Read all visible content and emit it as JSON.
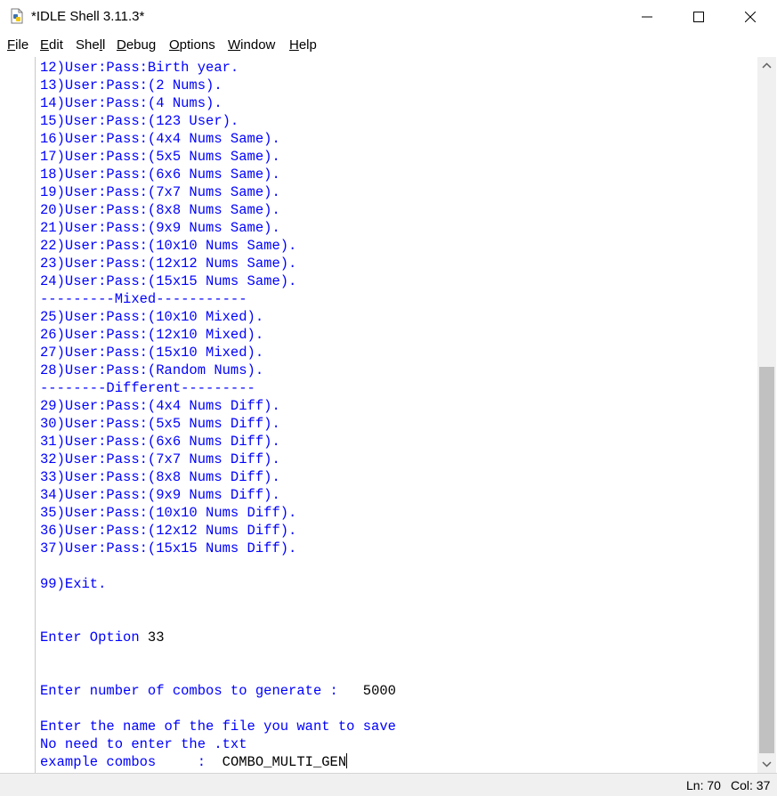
{
  "window": {
    "title": "*IDLE Shell 3.11.3*"
  },
  "menu": [
    "File",
    "Edit",
    "Shell",
    "Debug",
    "Options",
    "Window",
    "Help"
  ],
  "menu_mnemonics": [
    "F",
    "E",
    "l",
    "D",
    "O",
    "W",
    "H"
  ],
  "shell_lines": [
    {
      "text": "12)User:Pass:Birth year.",
      "kind": "output"
    },
    {
      "text": "13)User:Pass:(2 Nums).",
      "kind": "output"
    },
    {
      "text": "14)User:Pass:(4 Nums).",
      "kind": "output"
    },
    {
      "text": "15)User:Pass:(123 User).",
      "kind": "output"
    },
    {
      "text": "16)User:Pass:(4x4 Nums Same).",
      "kind": "output"
    },
    {
      "text": "17)User:Pass:(5x5 Nums Same).",
      "kind": "output"
    },
    {
      "text": "18)User:Pass:(6x6 Nums Same).",
      "kind": "output"
    },
    {
      "text": "19)User:Pass:(7x7 Nums Same).",
      "kind": "output"
    },
    {
      "text": "20)User:Pass:(8x8 Nums Same).",
      "kind": "output"
    },
    {
      "text": "21)User:Pass:(9x9 Nums Same).",
      "kind": "output"
    },
    {
      "text": "22)User:Pass:(10x10 Nums Same).",
      "kind": "output"
    },
    {
      "text": "23)User:Pass:(12x12 Nums Same).",
      "kind": "output"
    },
    {
      "text": "24)User:Pass:(15x15 Nums Same).",
      "kind": "output"
    },
    {
      "text": "---------Mixed-----------",
      "kind": "output"
    },
    {
      "text": "25)User:Pass:(10x10 Mixed).",
      "kind": "output"
    },
    {
      "text": "26)User:Pass:(12x10 Mixed).",
      "kind": "output"
    },
    {
      "text": "27)User:Pass:(15x10 Mixed).",
      "kind": "output"
    },
    {
      "text": "28)User:Pass:(Random Nums).",
      "kind": "output"
    },
    {
      "text": "--------Different---------",
      "kind": "output"
    },
    {
      "text": "29)User:Pass:(4x4 Nums Diff).",
      "kind": "output"
    },
    {
      "text": "30)User:Pass:(5x5 Nums Diff).",
      "kind": "output"
    },
    {
      "text": "31)User:Pass:(6x6 Nums Diff).",
      "kind": "output"
    },
    {
      "text": "32)User:Pass:(7x7 Nums Diff).",
      "kind": "output"
    },
    {
      "text": "33)User:Pass:(8x8 Nums Diff).",
      "kind": "output"
    },
    {
      "text": "34)User:Pass:(9x9 Nums Diff).",
      "kind": "output"
    },
    {
      "text": "35)User:Pass:(10x10 Nums Diff).",
      "kind": "output"
    },
    {
      "text": "36)User:Pass:(12x12 Nums Diff).",
      "kind": "output"
    },
    {
      "text": "37)User:Pass:(15x15 Nums Diff).",
      "kind": "output"
    },
    {
      "text": "",
      "kind": "output"
    },
    {
      "text": "99)Exit.",
      "kind": "output"
    },
    {
      "text": "",
      "kind": "output"
    },
    {
      "text": "",
      "kind": "output"
    },
    {
      "text": "Enter Option ",
      "kind": "output",
      "input": "33"
    },
    {
      "text": "",
      "kind": "output"
    },
    {
      "text": "",
      "kind": "output"
    },
    {
      "text": "Enter number of combos to generate :   ",
      "kind": "output",
      "input": "5000"
    },
    {
      "text": "",
      "kind": "output"
    },
    {
      "text": "Enter the name of the file you want to save",
      "kind": "output"
    },
    {
      "text": "No need to enter the .txt",
      "kind": "output"
    },
    {
      "text": "example combos     :  ",
      "kind": "output",
      "input": "COMBO_MULTI_GEN",
      "cursor": true
    }
  ],
  "status": {
    "line": "Ln: 70",
    "col": "Col: 37"
  },
  "colors": {
    "output": "#0000ff",
    "input": "#000000"
  }
}
